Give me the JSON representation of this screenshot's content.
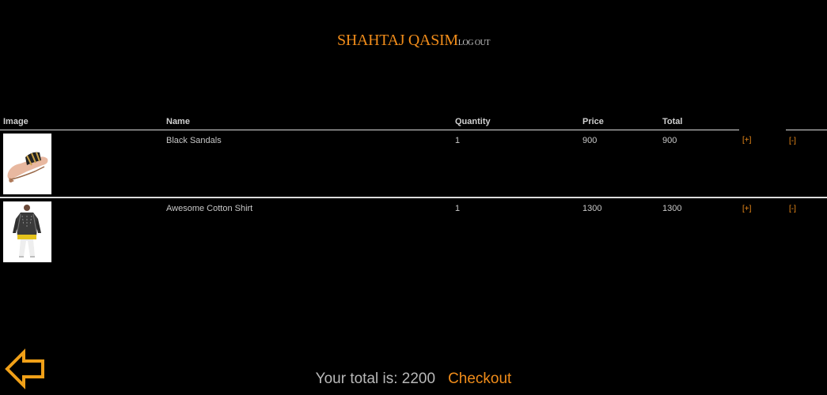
{
  "header": {
    "user_name": "SHAHTAJ QASIM",
    "logout_label": "LOG OUT"
  },
  "table": {
    "columns": {
      "image": "Image",
      "name": "Name",
      "quantity": "Quantity",
      "price": "Price",
      "total": "Total"
    },
    "rows": [
      {
        "image_icon": "sandal-thumbnail",
        "name": "Black Sandals",
        "quantity": "1",
        "price": "900",
        "total": "900",
        "increase_label": "[+]",
        "decrease_label": "[-]"
      },
      {
        "image_icon": "shirt-thumbnail",
        "name": "Awesome Cotton Shirt",
        "quantity": "1",
        "price": "1300",
        "total": "1300",
        "increase_label": "[+]",
        "decrease_label": "[-]"
      }
    ]
  },
  "footer": {
    "total_text": "Your total is: 2200",
    "checkout_label": "Checkout"
  },
  "colors": {
    "background": "#000000",
    "accent": "#f08c1a",
    "text": "#cfcfcf"
  },
  "icons": {
    "back": "arrow-left-icon"
  }
}
